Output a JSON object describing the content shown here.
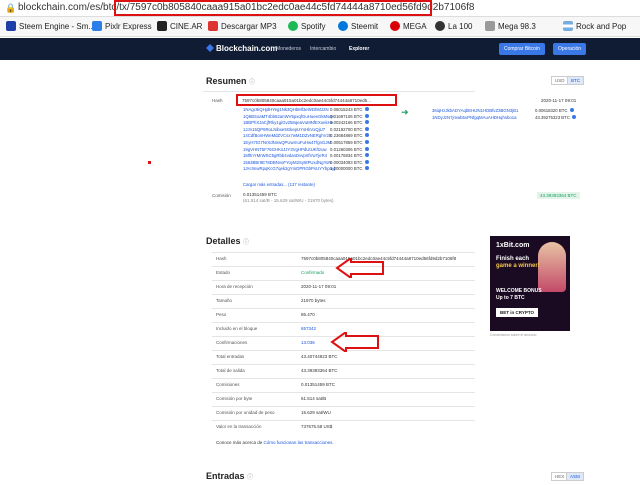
{
  "browser": {
    "url": "blockchain.com/es/btc/tx/7597c0b805840caaa915a01bc2edc0ae44c5fd74444a8710ed56fd9d2b7106f8",
    "bookmarks": [
      "Steem Engine - Sm...",
      "Pixlr Express",
      "CINE.AR",
      "Descargar MP3",
      "Spotify",
      "Steemit",
      "MEGA",
      "La 100",
      "Mega 98.3",
      "Rock and Pop"
    ]
  },
  "nav": {
    "logo": "Blockchain.com",
    "links": [
      "Monederos",
      "Intercambio",
      "Explorer"
    ],
    "buy_button": "Comprar Bitcoin",
    "op_button": "Operación"
  },
  "summary": {
    "title": "Resumen",
    "currency_toggle": [
      "USD",
      "BTC"
    ],
    "hash_label": "Hash",
    "hash": "7597c0b805840caaa915a01bc2edc0ae44c5fd74444a8710ed5...",
    "date": "2020-11-17 09:01",
    "inputs": [
      {
        "addr": "1NAgc9iQHjdHYeg1Nk3QHbMf3eWDhMJ2N",
        "amt": "0.06015243 BTC"
      },
      {
        "addr": "1Q6BSoaMT4bb62anWV5pxqfGuHueeGkMsqA",
        "amt": "0.01697106 BTC"
      },
      {
        "addr": "1BBPhXJaCjfRky1giGv258qeaVuMNfEXoekHe",
        "amt": "0.00242166 BTC"
      },
      {
        "addr": "1JJn15QP6RoLNibxe5GkepUYsHkVxQjU7",
        "amt": "0.02192700 BTC"
      },
      {
        "addr": "14CdfBonHWeMdZVCsx7wM1DZvNERghV2E",
        "amt": "0.23684869 BTC"
      },
      {
        "addr": "1EyH7tG7NrXdNnwQPUwrnuFuHw4TfgnGJM",
        "amt": "0.00517859 BTC"
      },
      {
        "addr": "19gVHNT5F76GHKsJJY3VgHPdUtUKftzuw",
        "amt": "0.01260306 BTC"
      },
      {
        "addr": "1MftnYMrWSC5gRbb4vdanDvvprtfVwTjeR4",
        "amt": "0.00176834 BTC"
      },
      {
        "addr": "1563BBr9E78DBNvoFYoyM2Sy5tPUxdNgYoN",
        "amt": "0.00034093 BTC"
      },
      {
        "addr": "1JHJmwRpqKcG7qek2gYmDPRGbPsUYYbpnyj",
        "amt": "1.00000000 BTC"
      }
    ],
    "more_inputs": "Cargar más entradas... (137 restante)",
    "outputs": [
      {
        "addr": "36iqHzJkbADYAqbEHtJN1HDBfvZ3BGN3jB1",
        "amt": "0.00618320 BTC"
      },
      {
        "addr": "1NDyJzN7jmwb5xPNfgqMAuAHDHqhsbo1a",
        "amt": "43.39275323 BTC"
      }
    ],
    "fee_label": "Comisión",
    "fee_value": "0.01351459 BTC",
    "fee_detail": "(61.514 sat/B - 15.629 sat/WU - 21970 bytes)",
    "total": "43.39393364 BTC"
  },
  "details": {
    "title": "Detalles",
    "rows": [
      {
        "label": "Hash",
        "value": "7597c0b805840caaa915a01bc2edc0ae44c5fd74444a8710ed56fd9d2b7106f8"
      },
      {
        "label": "Estado",
        "value": "Confirmado"
      },
      {
        "label": "Hora de recepción",
        "value": "2020-11-17 09:01"
      },
      {
        "label": "Tamaño",
        "value": "21970 bytes"
      },
      {
        "label": "Peso",
        "value": "86.470"
      },
      {
        "label": "Incluido en el bloque",
        "value": "657342"
      },
      {
        "label": "Confirmaciones",
        "value": "13.036"
      },
      {
        "label": "Total entradas",
        "value": "43.40744823 BTC"
      },
      {
        "label": "Total de salida",
        "value": "43.39393364 BTC"
      },
      {
        "label": "Comisiones",
        "value": "0.01351459 BTC"
      },
      {
        "label": "Comisión por byte",
        "value": "61.514 sat/B"
      },
      {
        "label": "Comisión por unidad de peso",
        "value": "15.629 sat/WU"
      },
      {
        "label": "Valor en la transacción",
        "value": "737675.58 US$"
      }
    ],
    "learn_prefix": "Conoce más acerca de",
    "learn_link": "Cómo funcionan las transacciones."
  },
  "entries": {
    "title": "Entradas",
    "toggle": [
      "HEX",
      "ASM"
    ]
  },
  "ad": {
    "brand": "1xBit.com",
    "line1": "Finish each",
    "line2": "game a winner!",
    "line3": "WELCOME BONUS",
    "line4": "Up to 7 BTC",
    "button": "BET in CRYPTO",
    "note": "Comentarios sobre el anuncio"
  }
}
